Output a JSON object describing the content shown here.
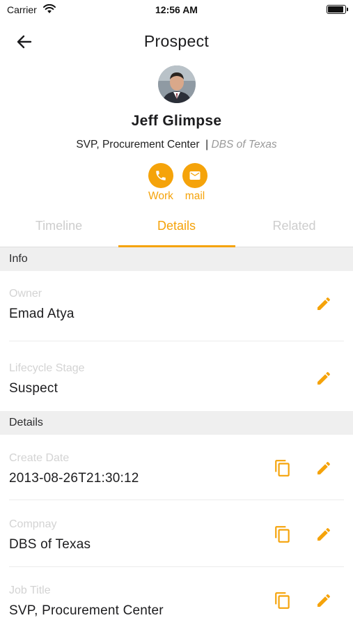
{
  "status_bar": {
    "carrier": "Carrier",
    "time": "12:56 AM"
  },
  "nav": {
    "title": "Prospect",
    "back_icon": "arrow-left-icon"
  },
  "profile": {
    "name": "Jeff Glimpse",
    "title": "SVP, Procurement Center",
    "separator": "|",
    "company": "DBS of Texas",
    "actions": [
      {
        "label": "Work",
        "icon": "phone-icon"
      },
      {
        "label": "mail",
        "icon": "mail-icon"
      }
    ]
  },
  "tabs": [
    {
      "label": "Timeline",
      "active": false
    },
    {
      "label": "Details",
      "active": true
    },
    {
      "label": "Related",
      "active": false
    }
  ],
  "sections": {
    "info": {
      "header": "Info",
      "fields": [
        {
          "label": "Owner",
          "value": "Emad Atya"
        },
        {
          "label": "Lifecycle Stage",
          "value": "Suspect"
        }
      ]
    },
    "details": {
      "header": "Details",
      "fields": [
        {
          "label": "Create Date",
          "value": "2013-08-26T21:30:12"
        },
        {
          "label": "Compnay",
          "value": "DBS of Texas"
        },
        {
          "label": "Job Title",
          "value": "SVP, Procurement Center"
        }
      ]
    }
  },
  "colors": {
    "accent": "#f5a30a",
    "section_bg": "#efefef",
    "muted_text": "#d3d3d3"
  }
}
